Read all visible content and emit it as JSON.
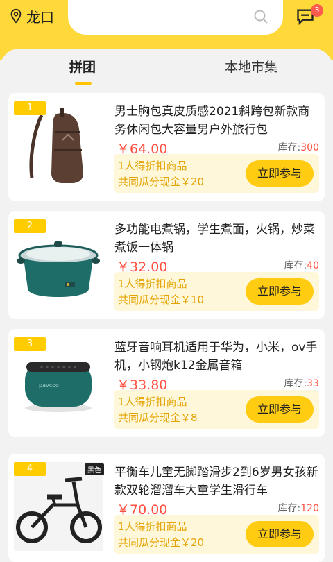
{
  "header": {
    "location": "龙口",
    "search_placeholder": "",
    "message_badge": "3",
    "icons": {
      "location": "location-pin-icon",
      "search": "search-icon",
      "message": "message-icon"
    }
  },
  "tabs": [
    {
      "label": "拼团",
      "active": true
    },
    {
      "label": "本地市集",
      "active": false
    }
  ],
  "products": [
    {
      "rank": "1",
      "title": "男士胸包真皮质感2021斜跨包新款商务休闲包大容量男户外旅行包",
      "price": "￥64.00",
      "stock_label": "库存:",
      "stock": "300",
      "deal_line1": "1人得折扣商品",
      "deal_line2": "共同瓜分现金￥20",
      "join_label": "立即参与"
    },
    {
      "rank": "2",
      "title": "多功能电煮锅，学生煮面，火锅，炒菜煮饭一体锅",
      "price": "￥32.00",
      "stock_label": "库存:",
      "stock": "40",
      "deal_line1": "1人得折扣商品",
      "deal_line2": "共同瓜分现金￥10",
      "join_label": "立即参与"
    },
    {
      "rank": "3",
      "title": "蓝牙音响耳机适用于华为，小米，ov手机，小钢炮k12金属音箱",
      "price": "￥33.80",
      "stock_label": "库存:",
      "stock": "33",
      "deal_line1": "1人得折扣商品",
      "deal_line2": "共同瓜分现金￥8",
      "join_label": "立即参与",
      "speaker_brand": "pavcoo"
    },
    {
      "rank": "4",
      "title": "平衡车儿童无脚踏滑步2到6岁男女孩新款双轮溜溜车大童学生滑行车",
      "price": "￥70.00",
      "stock_label": "库存:",
      "stock": "120",
      "deal_line1": "1人得折扣商品",
      "deal_line2": "共同瓜分现金￥20",
      "join_label": "立即参与",
      "color_tag": "黑色"
    }
  ],
  "colors": {
    "header_bg": "#ffd83a",
    "accent": "#ffcc11",
    "price": "#ff5040",
    "deal_text": "#e3a300"
  }
}
